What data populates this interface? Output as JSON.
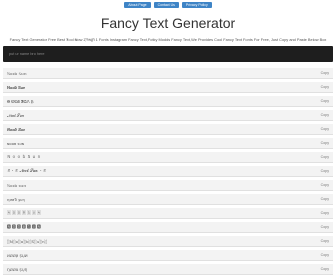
{
  "nav": {
    "buttons": [
      "About Page",
      "Contact Us",
      "Privacy Policy"
    ]
  },
  "title": "Fancy Text Generator",
  "tagline": "Fancy Text Generator Free Best ₮ool ₦ow ȤŦ𝔞ꝗᥒ 1 Fonts Instagram Fancy Text,Fotky Modds Fancy Text,We Provides Cool Fancy Text Fonts For Free, Just Copy and Paste Below Box",
  "input": {
    "placeholder": "put ur name bro here"
  },
  "copy_label": "Copy",
  "rows": [
    "ℕ𝕠𝕠𝕓 𝕊𝕦𝕟",
    "𝐍𝐨𝐨𝐛 𝐒𝐮𝐧",
    "Ꮎ ᎧᎧᏰ ᏕᏬᏁ ₿",
    "𝒩𝑜𝑜𝒷 𝒮𝓊𝓃",
    "𝑵𝒐𝒐𝒃 𝑺𝒖𝒏",
    "ɴᴏᴏʙ ꜱᴜɴ",
    "Ｎ ｏ ｏ ｂ Ｓ ｕ ｎ",
    "ミ・ミ 𝓝𝓸𝓸𝓫 𝓢𝓾𝓷 ・ミ",
    "ℕ𝕠𝕠𝕓 𝕤𝕦𝕟",
    "ɳσσႦ ʂυɳ",
    "🄽 🄾 🄾 🄱 🅂 🅄 🄽",
    "🅽 🅾 🅾 🅱 🆂 🆄 🅽",
    "░N░o░o░b░S░u░n░",
    "ИØØβ ŞЏИ",
    "ŊØØß ŞŲŊ"
  ]
}
